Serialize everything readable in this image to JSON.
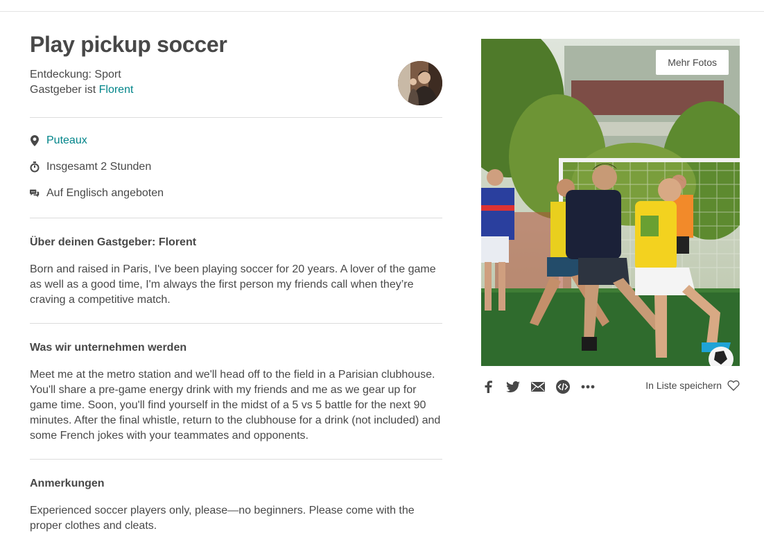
{
  "experience": {
    "title": "Play pickup soccer",
    "category_label": "Entdeckung: Sport",
    "host_prefix": "Gastgeber ist ",
    "host_name": "Florent"
  },
  "facts": {
    "location": "Puteaux",
    "duration": "Insgesamt 2 Stunden",
    "language": "Auf Englisch angeboten"
  },
  "about_host": {
    "title": "Über deinen Gastgeber: Florent",
    "body": "Born and raised in Paris, I've been playing soccer for 20 years. A lover of the game as well as a good time, I'm always the first person my friends call when they’re craving a competitive match."
  },
  "what_we_do": {
    "title": "Was wir unternehmen werden",
    "body": "Meet me at the metro station and we'll head off to the field in a Parisian clubhouse. You'll share a pre-game energy drink with my friends and me as we gear up for game time. Soon, you'll find yourself in the midst of a 5 vs 5 battle for the next 90 minutes. After the final whistle, return to the clubhouse for a drink (not included) and some French jokes with your teammates and opponents."
  },
  "notes": {
    "title": "Anmerkungen",
    "body": "Experienced soccer players only, please—no beginners. Please come with the proper clothes and cleats."
  },
  "photo": {
    "more_photos_label": "Mehr Fotos"
  },
  "share": {
    "icons": [
      "facebook-icon",
      "twitter-icon",
      "email-icon",
      "embed-icon",
      "more-icon"
    ],
    "save_label": "In Liste speichern"
  },
  "colors": {
    "link": "#008489",
    "text": "#484848",
    "divider": "#dcdcdc"
  }
}
